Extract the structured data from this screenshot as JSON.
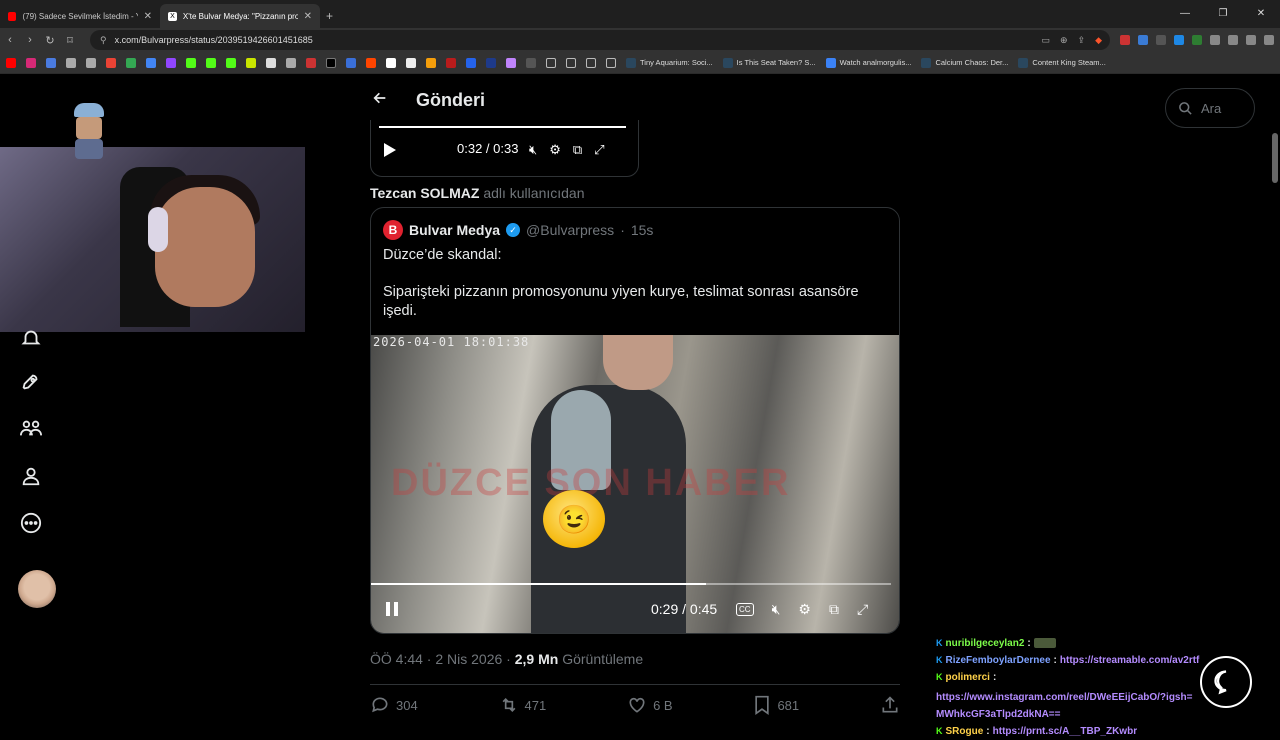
{
  "browser": {
    "tabs": [
      {
        "title": "(79) Sadece Sevilmek İstedim - Yo",
        "favicon_color": "#ff0000",
        "active": false
      },
      {
        "title": "X'te Bulvar Medya: \"Pizzanın pro",
        "favicon_color": "#000000",
        "active": true
      }
    ],
    "new_tab": "+",
    "url": "x.com/Bulvarpress/status/2039519426601451685",
    "bookmarks": [
      {
        "label": "Tiny Aquarium: Soci..."
      },
      {
        "label": "Is This Seat Taken? S..."
      },
      {
        "label": "Watch analmorgulis..."
      },
      {
        "label": "Calcium Chaos: Der..."
      },
      {
        "label": "Content King Steam..."
      }
    ],
    "window_controls": [
      "—",
      "❐",
      "✕"
    ]
  },
  "header": {
    "title": "Gönderi",
    "back_icon": "arrow-left-icon"
  },
  "search": {
    "placeholder": "Ara"
  },
  "prev_video": {
    "time": "0:32 / 0:33"
  },
  "reply_from": {
    "name": "Tezcan SOLMAZ",
    "suffix": "adlı kullanıcıdan"
  },
  "quote": {
    "logo": "B",
    "name": "Bulvar Medya",
    "handle": "@Bulvarpress",
    "sep": "·",
    "time": "15s",
    "line1": "Düzce’de skandal:",
    "line2": "Siparişteki pizzanın promosyonunu yiyen kurye, teslimat sonrası asansöre işedi.",
    "video": {
      "timestamp": "2026-04-01 18:01:38",
      "watermark": "DÜZCE SON HABER",
      "time": "0:29 / 0:45",
      "progress": 0.644
    }
  },
  "meta": {
    "time": "ÖÖ 4:44 · 2 Nis 2026 ·",
    "views": "2,9 Mn",
    "views_label": "Görüntüleme"
  },
  "actions": {
    "replies": "304",
    "reposts": "471",
    "likes": "6 B",
    "bookmarks": "681"
  },
  "chat": [
    {
      "badge": "K",
      "badge_color": "#1d9bf0",
      "user": "nuribilgeceylan2",
      "user_color": "#7cfc4a",
      "text": ""
    },
    {
      "badge": "K",
      "badge_color": "#1d9bf0",
      "user": "RizeFemboylarDernee",
      "user_color": "#7ea2ff",
      "text": "https://streamable.com/av2rtf"
    },
    {
      "badge": "K",
      "badge_color": "#53fc18",
      "user": "polimerci",
      "user_color": "#ffd24a",
      "text": "https://www.instagram.com/reel/DWeEEijCabO/?igsh=MWhkcGF3aTlpd2dkNA=="
    },
    {
      "badge": "K",
      "badge_color": "#53fc18",
      "user": "SRogue",
      "user_color": "#ffd24a",
      "text": "https://prnt.sc/A__TBP_ZKwbr"
    }
  ],
  "colors": {
    "accent": "#1d9bf0",
    "link": "#b48cff",
    "muted": "#71767b",
    "border": "#2f3336"
  }
}
